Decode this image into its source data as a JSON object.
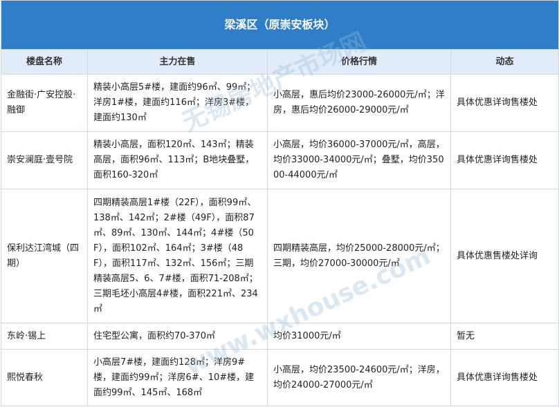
{
  "table": {
    "title": "梁溪区（原崇安板块）",
    "headers": [
      "楼盘名称",
      "主力在售",
      "价格行情",
      "动态"
    ],
    "rows": [
      {
        "name": "金融街·广安控股·融御",
        "supply": "精装小高层5#楼，建面约96㎡、99㎡；洋房1#楼，建面约116㎡；洋房3#楼，建面约130㎡",
        "price": "小高层，惠后均价23000-26000元/㎡；洋房，惠后均价26000-29000元/㎡",
        "status": "具体优惠详询售楼处"
      },
      {
        "name": "崇安澜庭·壹号院",
        "supply": "精装小高层，面积120㎡、143㎡；精装高层，面积96㎡、113㎡；B地块叠墅，面积160-320㎡",
        "price": "小高层，均价36000-37000元/㎡，高层，均价33000-34000元/㎡；叠墅，均价35000-44000元/㎡",
        "status": "具体优惠详询售楼处"
      },
      {
        "name": "保利达江湾城（四期）",
        "supply": "四期精装高层1#楼（22F），面积99㎡、138㎡、142㎡；2#楼（49F），面积87㎡、89㎡、130㎡、144㎡；4#楼（50F），面积102㎡、164㎡；3#楼（48F），面积117㎡、132㎡、156㎡；三期精装高层5、6、7#楼，面积71-208㎡；三期毛坯小高层4#楼，面积221㎡、234㎡",
        "price": "四期精装高层，均价25000-28000元/㎡；三期，均价27000-30000元/㎡",
        "status": "具体优惠售楼处详询"
      },
      {
        "name": "东岭·锡上",
        "supply": "住宅型公寓，面积约70-370㎡",
        "price": "均价31000元/㎡",
        "status": "暂无"
      },
      {
        "name": "熙悦春秋",
        "supply": "小高层7#楼，建面约128㎡；洋房9#楼，建面约99㎡；洋房6#、10#楼，建面约99㎡、145㎡、168㎡",
        "price": "小高层，均价23500-24600元/㎡；洋房，均价24000-27000元/㎡",
        "status": "具体优惠详询售楼处"
      }
    ]
  },
  "watermark": {
    "text_cn": "无锡房地产市场网",
    "text_url": "www.wxhouse.com"
  }
}
